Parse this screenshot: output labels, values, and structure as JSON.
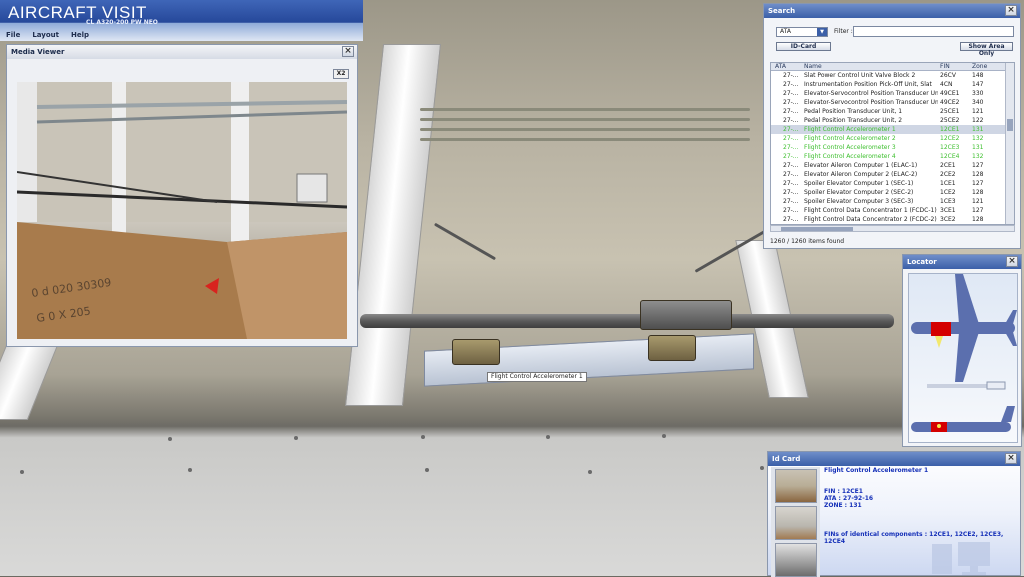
{
  "app": {
    "title": "AIRCRAFT VISIT",
    "subtitle": "CL A320-200 PW NEO",
    "menu": [
      "File",
      "Layout",
      "Help"
    ]
  },
  "media_viewer": {
    "title": "Media Viewer",
    "close_label": "×",
    "zoom_label": "X2"
  },
  "search": {
    "title": "Search",
    "close_label": "×",
    "select_value": "ATA",
    "filter_label": "Filter :",
    "filter_value": "",
    "idcard_button": "ID-Card",
    "show_area_button": "Show Area Only",
    "columns": [
      "ATA",
      "Name",
      "FIN",
      "Zone"
    ],
    "rows": [
      {
        "ata": "27-...",
        "name": "Slat Power Control Unit Valve Block 2",
        "fin": "26CV",
        "zone": "148",
        "state": "normal"
      },
      {
        "ata": "27-...",
        "name": "Instrumentation Position Pick-Off Unit, Slat",
        "fin": "4CN",
        "zone": "147",
        "state": "normal"
      },
      {
        "ata": "27-...",
        "name": "Elevator-Servocontrol Position Transducer Unit, L...",
        "fin": "49CE1",
        "zone": "330",
        "state": "normal"
      },
      {
        "ata": "27-...",
        "name": "Elevator-Servocontrol Position Transducer Unit, ...",
        "fin": "49CE2",
        "zone": "340",
        "state": "normal"
      },
      {
        "ata": "27-...",
        "name": "Pedal Position Transducer Unit, 1",
        "fin": "25CE1",
        "zone": "121",
        "state": "normal"
      },
      {
        "ata": "27-...",
        "name": "Pedal Position Transducer Unit, 2",
        "fin": "25CE2",
        "zone": "122",
        "state": "normal"
      },
      {
        "ata": "27-...",
        "name": "Flight Control Accelerometer 1",
        "fin": "12CE1",
        "zone": "131",
        "state": "selected"
      },
      {
        "ata": "27-...",
        "name": "Flight Control Accelerometer 2",
        "fin": "12CE2",
        "zone": "132",
        "state": "highlight"
      },
      {
        "ata": "27-...",
        "name": "Flight Control Accelerometer 3",
        "fin": "12CE3",
        "zone": "131",
        "state": "highlight"
      },
      {
        "ata": "27-...",
        "name": "Flight Control Accelerometer 4",
        "fin": "12CE4",
        "zone": "132",
        "state": "highlight"
      },
      {
        "ata": "27-...",
        "name": "Elevator Aileron Computer 1 (ELAC-1)",
        "fin": "2CE1",
        "zone": "127",
        "state": "normal"
      },
      {
        "ata": "27-...",
        "name": "Elevator Aileron Computer 2 (ELAC-2)",
        "fin": "2CE2",
        "zone": "128",
        "state": "normal"
      },
      {
        "ata": "27-...",
        "name": "Spoiler Elevator Computer 1 (SEC-1)",
        "fin": "1CE1",
        "zone": "127",
        "state": "normal"
      },
      {
        "ata": "27-...",
        "name": "Spoiler Elevator Computer 2 (SEC-2)",
        "fin": "1CE2",
        "zone": "128",
        "state": "normal"
      },
      {
        "ata": "27-...",
        "name": "Spoiler Elevator Computer 3 (SEC-3)",
        "fin": "1CE3",
        "zone": "121",
        "state": "normal"
      },
      {
        "ata": "27-...",
        "name": "Flight Control Data Concentrator 1 (FCDC-1)",
        "fin": "3CE1",
        "zone": "127",
        "state": "normal"
      },
      {
        "ata": "27-...",
        "name": "Flight Control Data Concentrator 2 (FCDC-2)",
        "fin": "3CE2",
        "zone": "128",
        "state": "normal"
      }
    ],
    "items_found": "1260 / 1260 items found"
  },
  "locator": {
    "title": "Locator",
    "close_label": "×"
  },
  "idcard": {
    "title": "Id Card",
    "close_label": "×",
    "name": "Flight Control Accelerometer 1",
    "fin": "FIN : 12CE1",
    "ata": "ATA : 27-92-16",
    "zone": "ZONE : 131",
    "identical": "FINs of identical components : 12CE1, 12CE2, 12CE3, 12CE4"
  },
  "tooltip": "Flight Control Accelerometer 1",
  "colors": {
    "accent": "#3b5fa8",
    "highlight_green": "#3cbf2d",
    "idcard_text": "#1530b8"
  }
}
